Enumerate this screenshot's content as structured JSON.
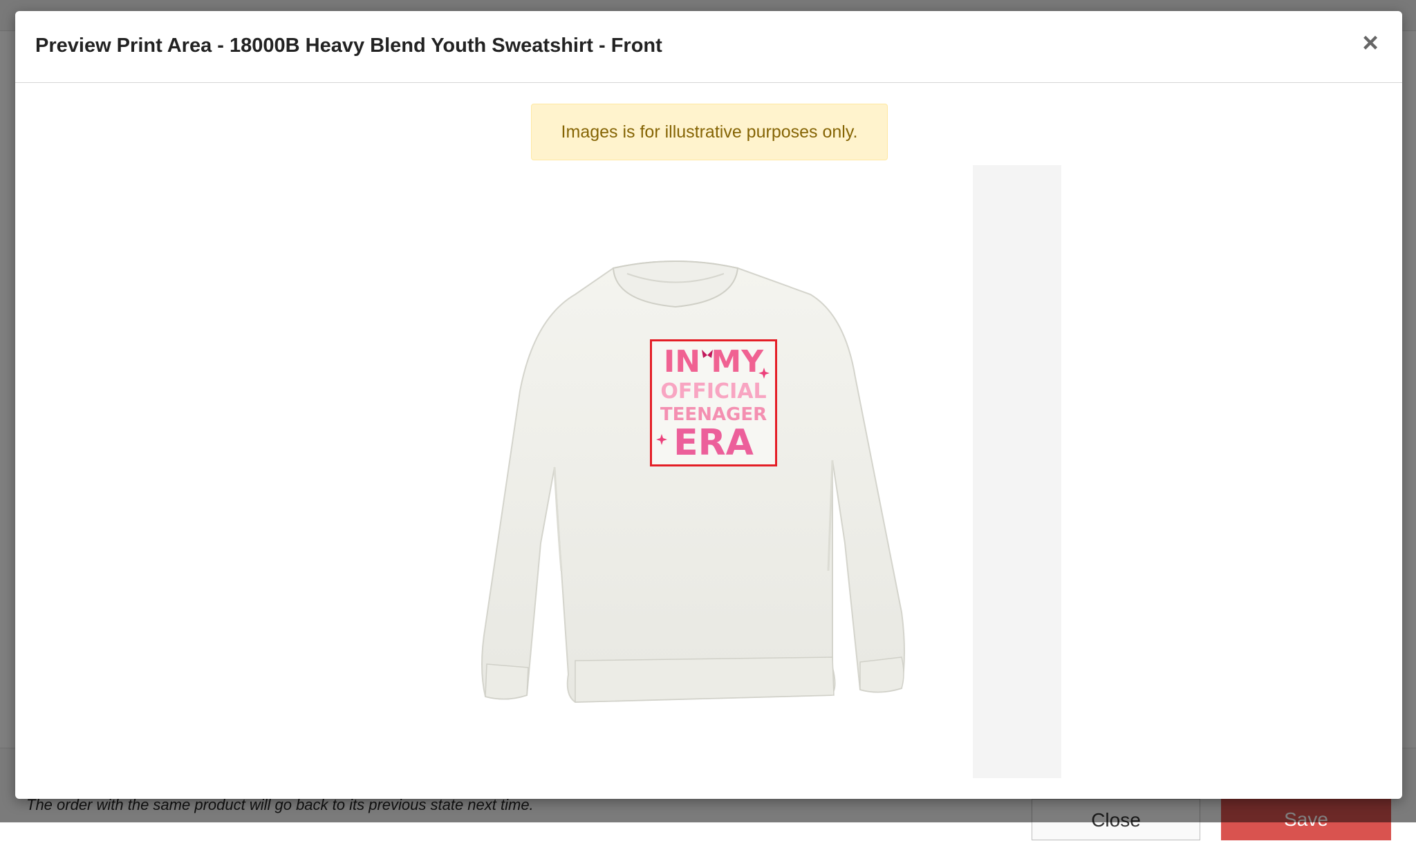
{
  "background": {
    "footer_note": "The order with the same product will go back to its previous state next time.",
    "close_label": "Close",
    "save_label": "Save"
  },
  "modal": {
    "title": "Preview Print Area - 18000B Heavy Blend Youth Sweatshirt - Front",
    "close_icon": "×",
    "alert_text": "Images is for illustrative purposes only."
  },
  "design": {
    "lines": [
      "IN MY",
      "OFFICIAL",
      "TEENAGER",
      "ERA"
    ]
  },
  "colors": {
    "print_area_border": "#e41e26",
    "alert_bg": "#fff3cd",
    "alert_text": "#856404",
    "save_button": "#d9534f",
    "design_pink": "#f06292",
    "design_light_pink": "#f8bbd0"
  }
}
